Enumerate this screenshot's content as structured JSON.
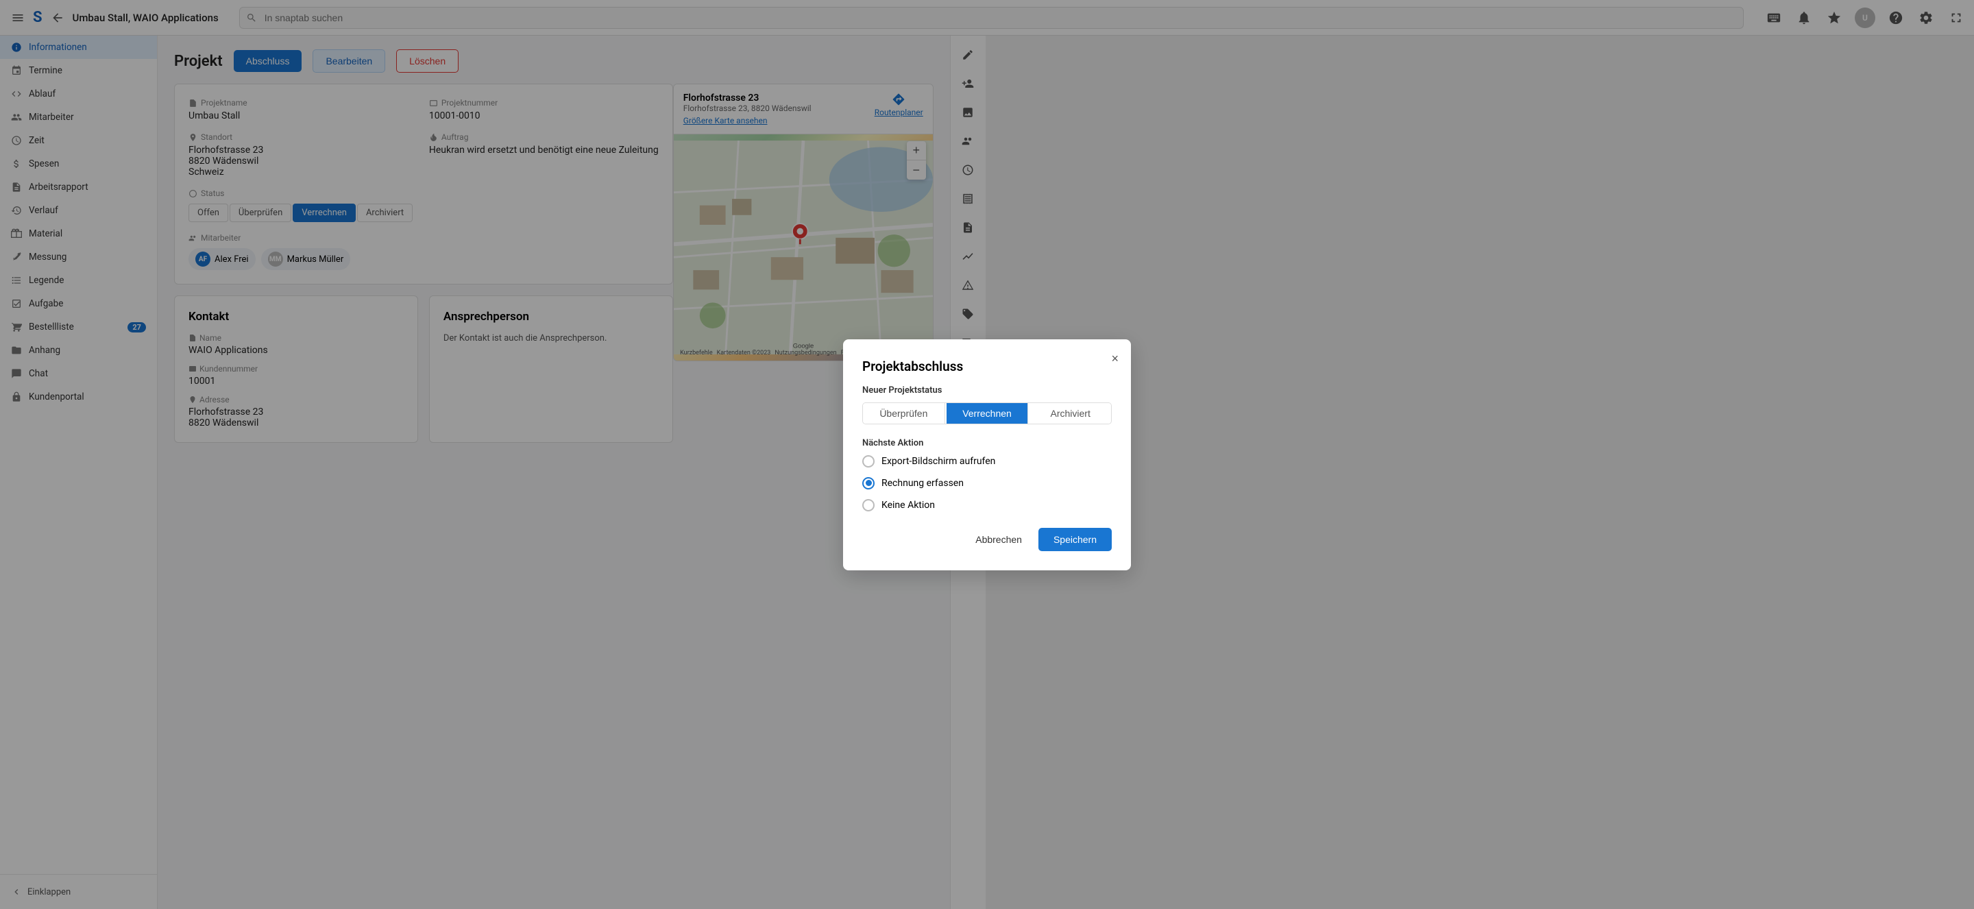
{
  "topbar": {
    "menu_icon": "≡",
    "logo": "S",
    "back_icon": "←",
    "title": "Umbau Stall, WAIO Applications",
    "search_placeholder": "In snaptab suchen",
    "keyboard_icon": "⌨",
    "notification_icon": "🔔",
    "star_icon": "★",
    "help_icon": "?",
    "settings_icon": "⚙",
    "edit_icon": "✏"
  },
  "sidebar": {
    "items": [
      {
        "id": "informationen",
        "label": "Informationen",
        "active": true
      },
      {
        "id": "termine",
        "label": "Termine"
      },
      {
        "id": "ablauf",
        "label": "Ablauf"
      },
      {
        "id": "mitarbeiter",
        "label": "Mitarbeiter"
      },
      {
        "id": "zeit",
        "label": "Zeit"
      },
      {
        "id": "spesen",
        "label": "Spesen"
      },
      {
        "id": "arbeitsrapport",
        "label": "Arbeitsrapport"
      },
      {
        "id": "verlauf",
        "label": "Verlauf"
      },
      {
        "id": "material",
        "label": "Material"
      },
      {
        "id": "messung",
        "label": "Messung"
      },
      {
        "id": "legende",
        "label": "Legende"
      },
      {
        "id": "aufgabe",
        "label": "Aufgabe"
      },
      {
        "id": "bestellliste",
        "label": "Bestellliste"
      },
      {
        "id": "anhang",
        "label": "Anhang"
      },
      {
        "id": "chat",
        "label": "Chat"
      },
      {
        "id": "kundenportal",
        "label": "Kundenportal"
      }
    ],
    "badge_count": "27",
    "collapse_label": "Einklappen"
  },
  "project": {
    "title": "Projekt",
    "buttons": {
      "abschluss": "Abschluss",
      "bearbeiten": "Bearbeiten",
      "loeschen": "Löschen"
    },
    "projektname_label": "Projektname",
    "projektname_value": "Umbau Stall",
    "projektnummer_label": "Projektnummer",
    "projektnummer_value": "10001-0010",
    "standort_label": "Standort",
    "standort_value": "Florhofstrasse 23\n8820 Wädenswil\nSchweiz",
    "auftrag_label": "Auftrag",
    "auftrag_value": "Heukran wird ersetzt und benötigt eine neue Zuleitung",
    "status_label": "Status",
    "status_tabs": [
      "Offen",
      "Überprüfen",
      "Verrechnen",
      "Archiviert"
    ],
    "status_active": "Verrechnen",
    "mitarbeiter_label": "Mitarbeiter",
    "members": [
      {
        "name": "Alex Frei",
        "initials": "AF",
        "color": "blue"
      },
      {
        "name": "Markus Müller",
        "initials": "MM",
        "color": "gray"
      }
    ]
  },
  "map": {
    "address": "Florhofstrasse 23",
    "address_sub": "Florhofstrasse 23, 8820 Wädenswil",
    "routenplaner": "Routenplaner",
    "groessere_karte": "Größere Karte ansehen"
  },
  "modal": {
    "title": "Projektabschluss",
    "close_icon": "×",
    "subtitle_status": "Neuer Projektstatus",
    "status_tabs": [
      "Überprüfen",
      "Verrechnen",
      "Archiviert"
    ],
    "status_active": "Verrechnen",
    "subtitle_action": "Nächste Aktion",
    "actions": [
      {
        "id": "export",
        "label": "Export-Bildschirm aufrufen",
        "checked": false
      },
      {
        "id": "rechnung",
        "label": "Rechnung erfassen",
        "checked": true
      },
      {
        "id": "keine",
        "label": "Keine Aktion",
        "checked": false
      }
    ],
    "cancel_label": "Abbrechen",
    "save_label": "Speichern"
  },
  "contact": {
    "title": "Kontakt",
    "name_label": "Name",
    "name_value": "WAIO Applications",
    "kundennummer_label": "Kundennummer",
    "kundennummer_value": "10001",
    "adresse_label": "Adresse",
    "adresse_value": "Florhofstrasse 23\n8820 Wädenswil"
  },
  "ansprechperson": {
    "title": "Ansprechperson",
    "text": "Der Kontakt ist auch die Ansprechperson."
  },
  "right_bar_icons": [
    "pencil",
    "person-plus",
    "image",
    "person-check",
    "clock",
    "receipt",
    "document",
    "chart",
    "alert",
    "tag",
    "truck",
    "document-list",
    "edit-icon2"
  ]
}
